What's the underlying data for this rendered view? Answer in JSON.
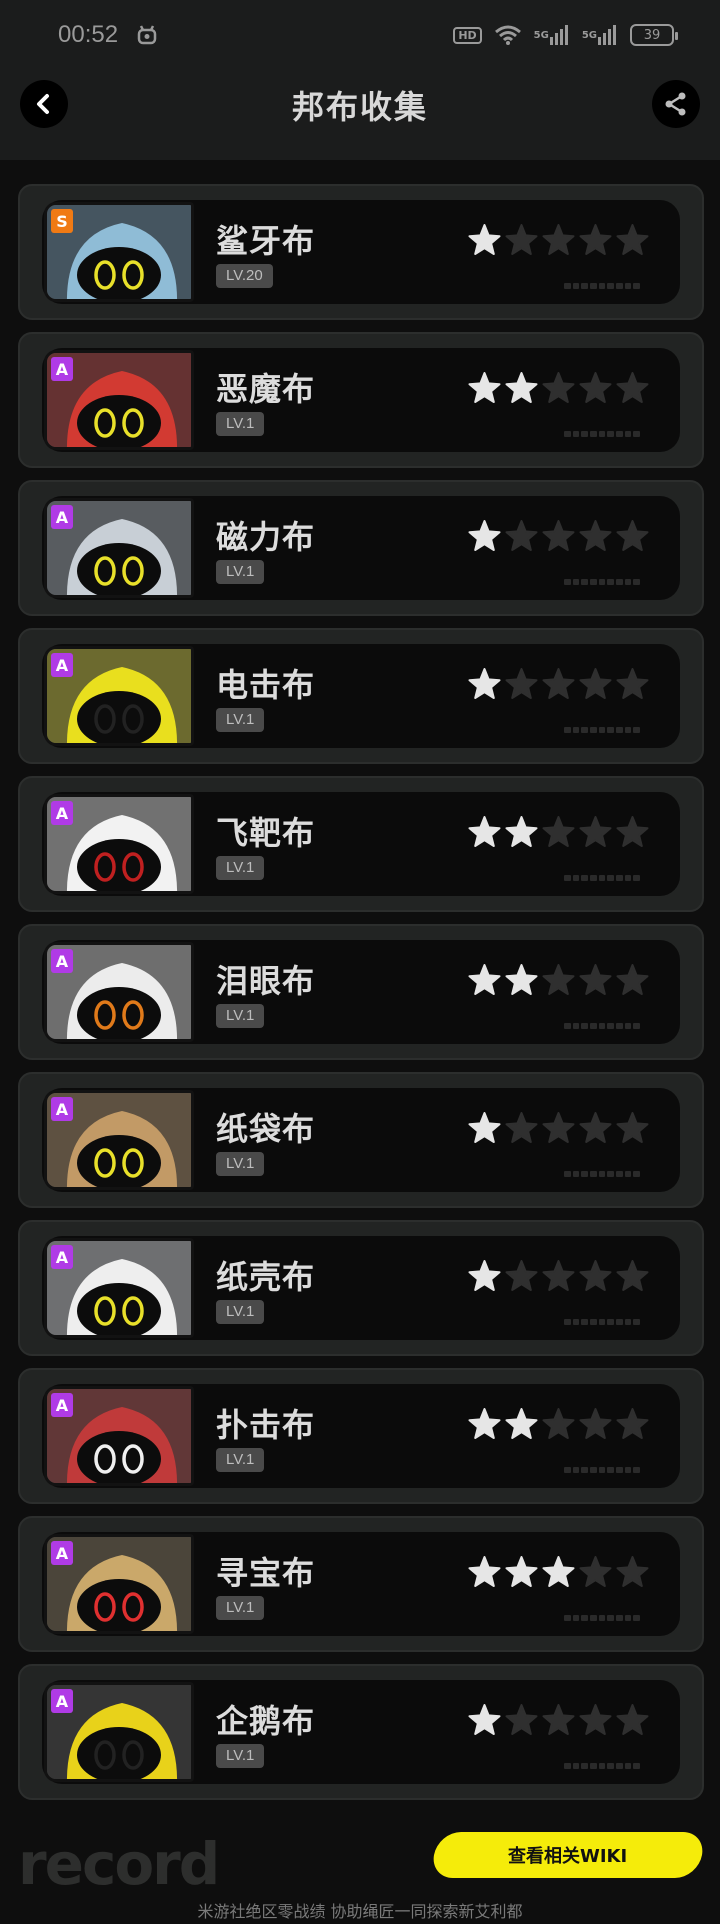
{
  "status_bar": {
    "time": "00:52",
    "hd_label": "HD",
    "signal1": "5G",
    "signal2": "5G",
    "battery": "39"
  },
  "header": {
    "title": "邦布收集",
    "back_icon": "chevron-left-icon",
    "share_icon": "share-icon"
  },
  "colors": {
    "accent_yellow": "#f5ec0a",
    "rank_S": "#f07a14",
    "rank_A": "#b03be6",
    "star_on": "#e6e6e6",
    "star_off": "#2f2f2f"
  },
  "bangboo": [
    {
      "name": "鲨牙布",
      "level": "LV.20",
      "rank": "S",
      "stars": 1,
      "portrait": {
        "bg": "#5a86a6",
        "body": "#8fbcd6",
        "eye": "#e8e02a"
      }
    },
    {
      "name": "恶魔布",
      "level": "LV.1",
      "rank": "A",
      "stars": 2,
      "portrait": {
        "bg": "#b42222",
        "body": "#d23a32",
        "eye": "#e8e02a"
      }
    },
    {
      "name": "磁力布",
      "level": "LV.1",
      "rank": "A",
      "stars": 1,
      "portrait": {
        "bg": "#8e9aa6",
        "body": "#c8cfd6",
        "eye": "#e8e02a"
      }
    },
    {
      "name": "电击布",
      "level": "LV.1",
      "rank": "A",
      "stars": 1,
      "portrait": {
        "bg": "#c9c21a",
        "body": "#e9df1e",
        "eye": "#222222"
      }
    },
    {
      "name": "飞靶布",
      "level": "LV.1",
      "rank": "A",
      "stars": 2,
      "portrait": {
        "bg": "#d8d8d8",
        "body": "#f2f2f2",
        "eye": "#c02020"
      }
    },
    {
      "name": "泪眼布",
      "level": "LV.1",
      "rank": "A",
      "stars": 2,
      "portrait": {
        "bg": "#cfcfcf",
        "body": "#ececec",
        "eye": "#e07a1a"
      }
    },
    {
      "name": "纸袋布",
      "level": "LV.1",
      "rank": "A",
      "stars": 1,
      "portrait": {
        "bg": "#a07a4c",
        "body": "#c29a66",
        "eye": "#e8e02a"
      }
    },
    {
      "name": "纸壳布",
      "level": "LV.1",
      "rank": "A",
      "stars": 1,
      "portrait": {
        "bg": "#cfd2d6",
        "body": "#eeeeee",
        "eye": "#e8e02a"
      }
    },
    {
      "name": "扑击布",
      "level": "LV.1",
      "rank": "A",
      "stars": 2,
      "portrait": {
        "bg": "#a83030",
        "body": "#c03a3a",
        "eye": "#f0f0f0"
      }
    },
    {
      "name": "寻宝布",
      "level": "LV.1",
      "rank": "A",
      "stars": 3,
      "portrait": {
        "bg": "#6a5a3a",
        "body": "#caa86a",
        "eye": "#e03030"
      }
    },
    {
      "name": "企鹅布",
      "level": "LV.1",
      "rank": "A",
      "stars": 1,
      "portrait": {
        "bg": "#2a2a2a",
        "body": "#e8d21a",
        "eye": "#222222"
      }
    }
  ],
  "total_stars": 5,
  "footer": {
    "logo": "record",
    "wiki_button": "查看相关WIKI",
    "tagline": "米游社绝区零战绩 协助绳匠一同探索新艾利都"
  }
}
